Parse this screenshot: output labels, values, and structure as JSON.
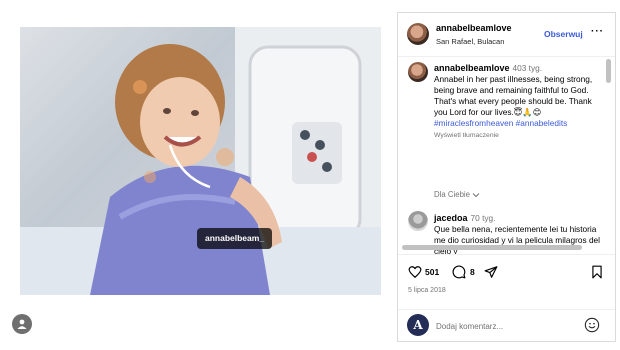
{
  "media": {
    "photo_tag": "annabelbeam_"
  },
  "post": {
    "username": "annabelbeamlove",
    "location": "San Rafael, Bulacan",
    "follow_label": "Obserwuj",
    "more_label": "···"
  },
  "caption": {
    "username": "annabelbeamlove",
    "time": "403 tyg.",
    "text": "Annabel in her past illnesses, being strong, being brave and remaining faithful to God. That's what every people should be. Thank you Lord for our lives.😇🙏😊",
    "hashtags": "#miraclesfromheaven #annabeledits",
    "translate_label": "Wyświetl tłumaczenie"
  },
  "sort_label": "Dla Ciebie",
  "comment": {
    "username": "jacedoa",
    "time": "70 tyg.",
    "text": "Que bella nena, recientemente lei tu historia me dio curiosidad y vi la pelicula milagros del cielo y"
  },
  "actions": {
    "like_icon": "heart-icon",
    "like_count": "501",
    "comment_icon": "speech-bubble-icon",
    "comment_count": "8",
    "share_icon": "paper-plane-icon",
    "save_icon": "bookmark-icon"
  },
  "date": "5 lipca 2018",
  "add_comment": {
    "placeholder": "Dodaj komentarz...",
    "avatar_letter": "A"
  },
  "colors": {
    "link": "#3a5ad9",
    "muted": "#737373",
    "border": "#dbdbdb"
  }
}
